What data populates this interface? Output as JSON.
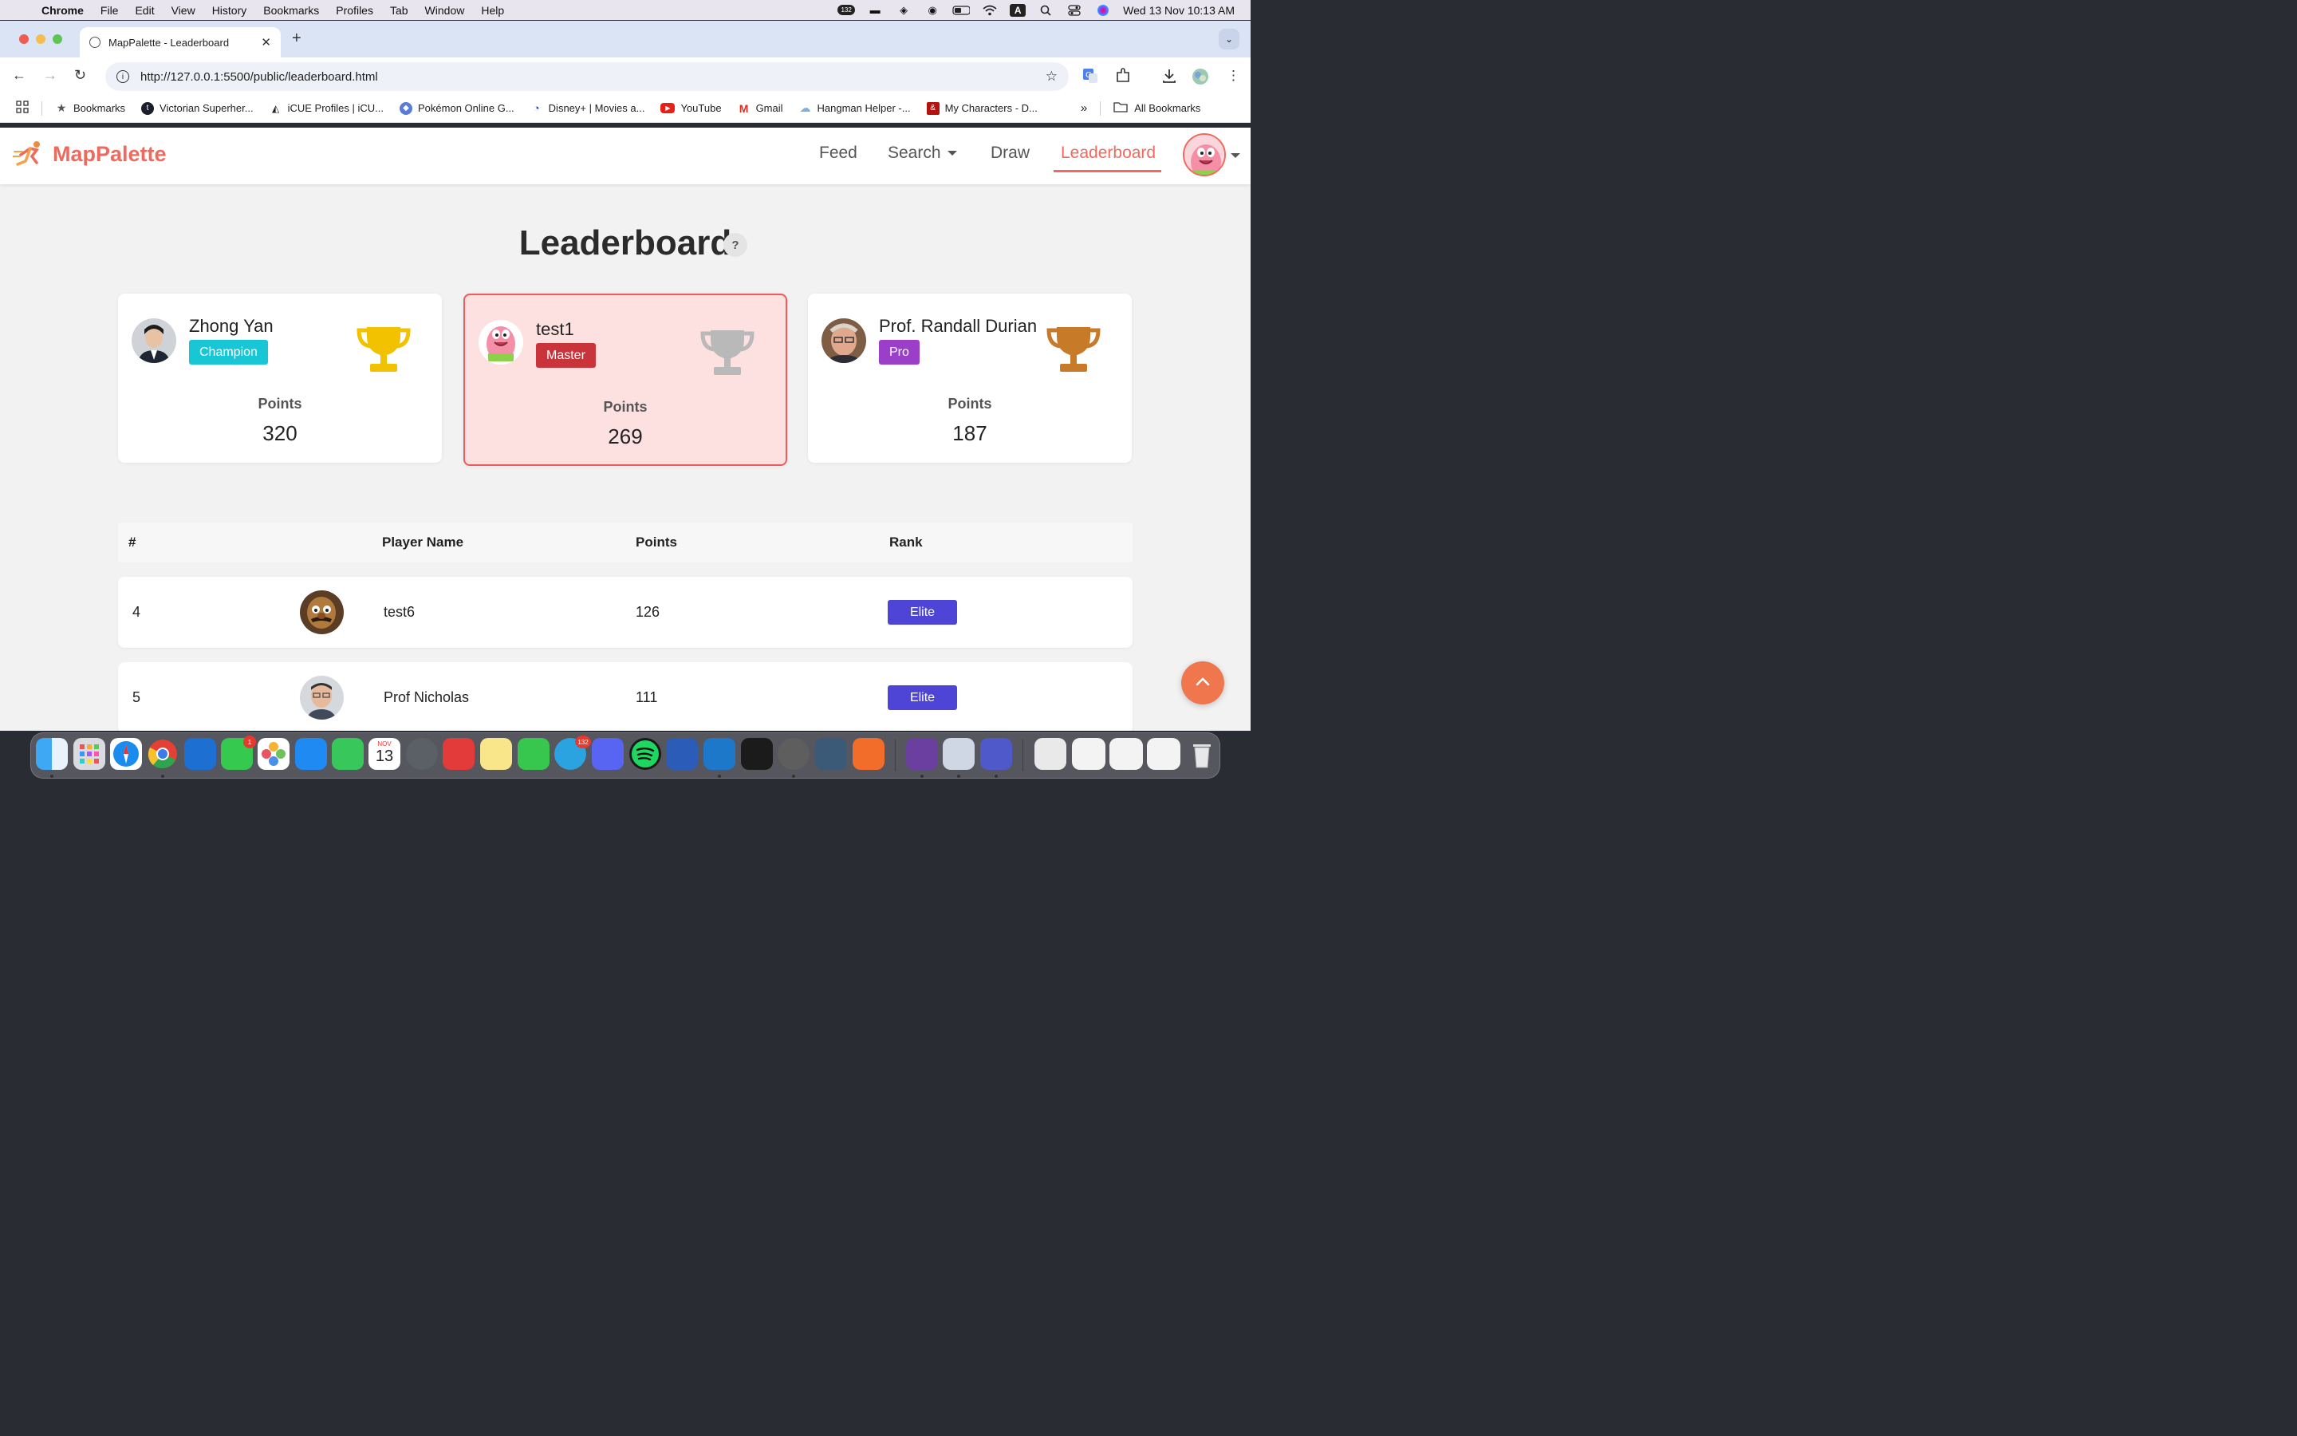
{
  "menubar": {
    "app": "Chrome",
    "items": [
      "File",
      "Edit",
      "View",
      "History",
      "Bookmarks",
      "Profiles",
      "Tab",
      "Window",
      "Help"
    ],
    "notif_count": "132",
    "input_source": "A",
    "clock": "Wed 13 Nov  10:13 AM"
  },
  "browser": {
    "tab_title": "MapPalette - Leaderboard",
    "url": "http://127.0.0.1:5500/public/leaderboard.html",
    "bookmarks": [
      {
        "label": "Bookmarks",
        "icon": "star-icon",
        "color": "#555555"
      },
      {
        "label": "Victorian Superher...",
        "icon": "tumblr-icon",
        "color": "#1b1f2a"
      },
      {
        "label": "iCUE Profiles | iCU...",
        "icon": "icue-icon",
        "color": "#222222"
      },
      {
        "label": "Pokémon Online G...",
        "icon": "pokemon-icon",
        "color": "#5a7bd6"
      },
      {
        "label": "Disney+ | Movies a...",
        "icon": "disney-icon",
        "color": "#1b3ab0"
      },
      {
        "label": "YouTube",
        "icon": "youtube-icon",
        "color": "#e62117"
      },
      {
        "label": "Gmail",
        "icon": "gmail-icon",
        "color": "#d93025"
      },
      {
        "label": "Hangman Helper -...",
        "icon": "cloud-icon",
        "color": "#7bb0e0"
      },
      {
        "label": "My Characters - D...",
        "icon": "dnd-icon",
        "color": "#b3120e"
      }
    ],
    "all_bookmarks": "All Bookmarks"
  },
  "site": {
    "brand": "MapPalette",
    "brand_color": "#ef6a5e",
    "nav": {
      "feed": "Feed",
      "search": "Search",
      "draw": "Draw",
      "leaderboard": "Leaderboard"
    }
  },
  "page": {
    "title": "Leaderboard",
    "help": "?"
  },
  "podium": [
    {
      "name": "Zhong Yan",
      "badge": "Champion",
      "badge_color": "#19c6d6",
      "trophy": "gold",
      "trophy_color": "#f2c200",
      "points_label": "Points",
      "points": "320"
    },
    {
      "name": "test1",
      "badge": "Master",
      "badge_color": "#c8343a",
      "trophy": "silver",
      "trophy_color": "#b9b9b9",
      "points_label": "Points",
      "points": "269"
    },
    {
      "name": "Prof. Randall Durian",
      "badge": "Pro",
      "badge_color": "#9b3fc9",
      "trophy": "bronze",
      "trophy_color": "#c77a28",
      "points_label": "Points",
      "points": "187"
    }
  ],
  "table": {
    "headers": {
      "rank_no": "#",
      "player": "Player Name",
      "points": "Points",
      "rank": "Rank"
    },
    "rows": [
      {
        "no": "4",
        "name": "test6",
        "points": "126",
        "rank": "Elite"
      },
      {
        "no": "5",
        "name": "Prof Nicholas",
        "points": "111",
        "rank": "Elite"
      }
    ],
    "rank_color": "#4e45d6"
  },
  "dock": {
    "calendar_month": "NOV",
    "calendar_day": "13",
    "messages_badge": "1",
    "telegram_badge": "132"
  }
}
